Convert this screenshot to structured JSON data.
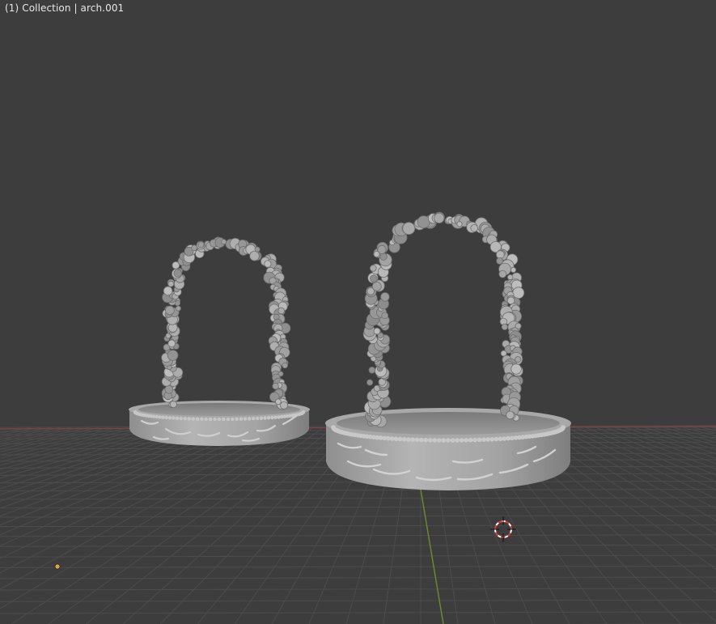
{
  "viewport": {
    "overlay_text": "(1) Collection | arch.001",
    "background_color": "#3d3d3d",
    "grid_color": "#4c4c4c",
    "x_axis_color": "#8a3e44",
    "y_axis_color": "#6d8d2c",
    "object_color": "#a9a9a9",
    "light_color": "#e8a24d",
    "cursor_color": "#d93a3a"
  },
  "scene": {
    "objects": [
      {
        "name": "arch",
        "type": "mesh"
      },
      {
        "name": "arch.001",
        "type": "mesh",
        "selected": true
      }
    ],
    "gizmos": [
      "3d-cursor",
      "light"
    ]
  }
}
